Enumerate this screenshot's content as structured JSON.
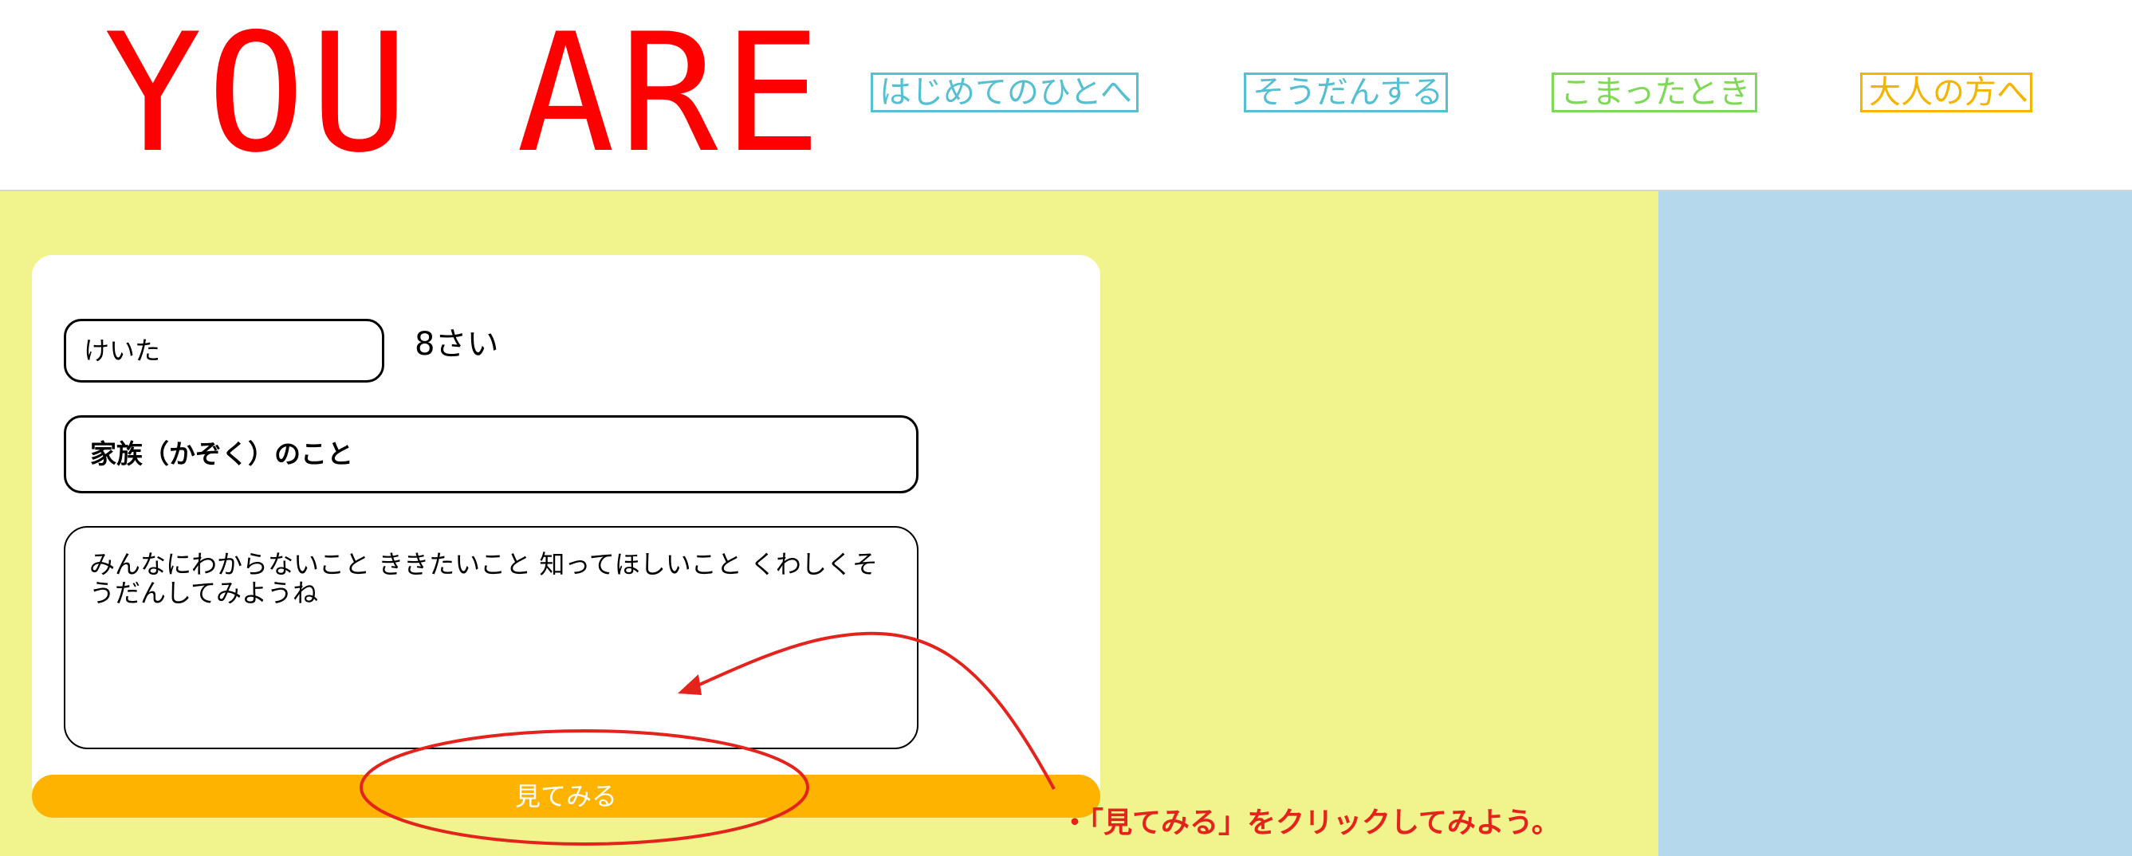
{
  "header": {
    "logo": "YOU ARE",
    "nav": [
      {
        "label": "はじめてのひとへ",
        "color": "#56bfd1"
      },
      {
        "label": "そうだんする",
        "color": "#56bfd1"
      },
      {
        "label": "こまったとき",
        "color": "#7ed957"
      },
      {
        "label": "大人の方へ",
        "color": "#f5b400"
      }
    ]
  },
  "form": {
    "name_value": "けいた",
    "age": "8さい",
    "topic": "家族（かぞく）のこと",
    "message_placeholder": "みんなにわからないこと ききたいこと 知ってほしいこと くわしくそうだんしてみようね",
    "view_button": "見てみる"
  },
  "annotation": {
    "instruction": "・「見てみる」をクリックしてみよう。",
    "color": "#e3231c"
  },
  "colors": {
    "main_bg": "#f1f48c",
    "side_bg": "#b5d8ec",
    "button": "#fdb300",
    "logo": "#ff0000"
  }
}
